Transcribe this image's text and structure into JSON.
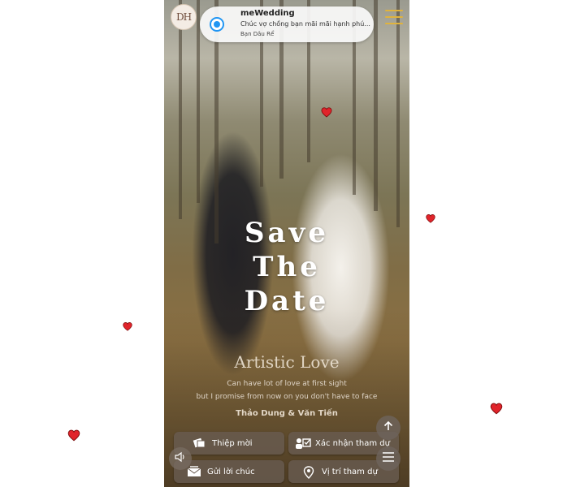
{
  "notification": {
    "title": "meWedding",
    "message": "Chúc vợ chồng bạn mãi mãi hạnh phú...",
    "sender": "Bạn Dâu Rể"
  },
  "logo": {
    "initials": "DH"
  },
  "hero": {
    "title": "Save The Date",
    "subtitle": "Artistic Love",
    "quote_line1": "Can have lot of love at first sight",
    "quote_line2": "but I promise from now on you don't have to face",
    "couple": "Thảo Dung & Văn Tiến"
  },
  "actions": {
    "invitation": "Thiệp mời",
    "confirm": "Xác nhận tham dự",
    "send_wishes": "Gửi lời chúc",
    "location": "Vị trí tham dự"
  },
  "icons": {
    "logo": "monogram-logo",
    "menu": "hamburger-menu-icon",
    "radio": "radio-selected-icon",
    "invitation": "invitation-card-icon",
    "confirm": "confirm-attendance-icon",
    "wishes": "envelope-icon",
    "location": "map-pin-icon",
    "scroll_top": "arrow-up-icon",
    "float_menu": "hamburger-icon",
    "audio": "speaker-icon",
    "heart": "heart-icon"
  },
  "colors": {
    "accent_menu": "#e0b33d",
    "radio": "#2196f3",
    "heart": "#e0242b",
    "button_bg": "#695c52"
  }
}
